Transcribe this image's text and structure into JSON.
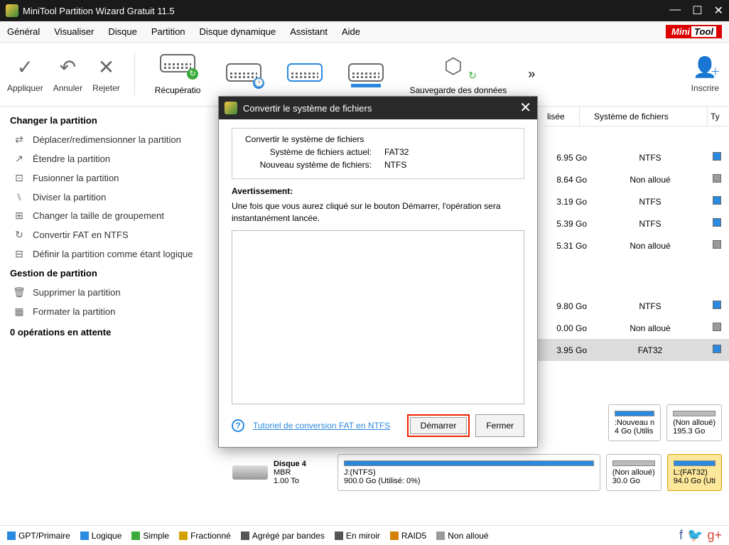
{
  "title": "MiniTool Partition Wizard Gratuit 11.5",
  "window_controls": {
    "min": "—",
    "max": "☐",
    "close": "✕"
  },
  "menus": [
    "Général",
    "Visualiser",
    "Disque",
    "Partition",
    "Disque dynamique",
    "Assistant",
    "Aide"
  ],
  "brand": {
    "mini": "Mini",
    "tool": "Tool"
  },
  "toolbar": {
    "apply": "Appliquer",
    "undo": "Annuler",
    "discard": "Rejeter",
    "recovery": "Récupératio",
    "backup": "Sauvegarde des données",
    "overflow": "»",
    "register": "Inscrire"
  },
  "sidebar": {
    "section1": "Changer la partition",
    "actions1": [
      "Déplacer/redimensionner la partition",
      "Étendre la partition",
      "Fusionner la partition",
      "Diviser la partition",
      "Changer la taille de groupement",
      "Convertir FAT en NTFS",
      "Définir la partition comme étant logique"
    ],
    "section2": "Gestion de partition",
    "actions2": [
      "Supprimer la partition",
      "Formater la partition"
    ],
    "pending": "0 opérations en attente"
  },
  "grid": {
    "col_used": "lisée",
    "col_fs": "Système de fichiers",
    "col_type": "Ty",
    "rows": [
      {
        "size": "6.95 Go",
        "fs": "NTFS",
        "type": "blue"
      },
      {
        "size": "8.64 Go",
        "fs": "Non alloué",
        "type": "gray"
      },
      {
        "size": "3.19 Go",
        "fs": "NTFS",
        "type": "blue"
      },
      {
        "size": "5.39 Go",
        "fs": "NTFS",
        "type": "blue"
      },
      {
        "size": "5.31 Go",
        "fs": "Non alloué",
        "type": "gray"
      },
      {
        "size": "9.80 Go",
        "fs": "NTFS",
        "type": "blue"
      },
      {
        "size": "0.00 Go",
        "fs": "Non alloué",
        "type": "gray"
      },
      {
        "size": "3.95 Go",
        "fs": "FAT32",
        "type": "blue",
        "sel": true
      }
    ]
  },
  "strip1": {
    "b1": {
      "l1": ":Nouveau n",
      "l2": "4 Go (Utilis"
    },
    "b2": {
      "l1": "(Non alloué)",
      "l2": "195.3 Go"
    }
  },
  "strip2": {
    "disk": {
      "name": "Disque 4",
      "type": "MBR",
      "size": "1.00 To"
    },
    "main": {
      "l1": "J:(NTFS)",
      "l2": "900.0 Go (Utilisé: 0%)"
    },
    "b2": {
      "l1": "(Non alloué)",
      "l2": "30.0 Go"
    },
    "b3": {
      "l1": "L:(FAT32)",
      "l2": "94.0 Go (Uti"
    }
  },
  "legend": {
    "items": [
      "GPT/Primaire",
      "Logique",
      "Simple",
      "Fractionné",
      "Agrégé par bandes",
      "En miroir",
      "RAID5",
      "Non alloué"
    ],
    "colors": [
      "#2a8adf",
      "#2a8adf",
      "#3aaa3a",
      "#d4a000",
      "#555",
      "#555",
      "#d48000",
      "#9a9a9a"
    ]
  },
  "modal": {
    "title": "Convertir le système de fichiers",
    "fieldset_title": "Convertir le système de fichiers",
    "current_label": "Système de fichiers actuel:",
    "current_value": "FAT32",
    "new_label": "Nouveau système de fichiers:",
    "new_value": "NTFS",
    "warning_h": "Avertissement:",
    "warning_t": "Une fois que vous aurez cliqué sur le bouton Démarrer, l'opération sera instantanément lancée.",
    "tutorial": "Tutoriel de conversion FAT en NTFS",
    "start": "Démarrer",
    "close": "Fermer"
  }
}
